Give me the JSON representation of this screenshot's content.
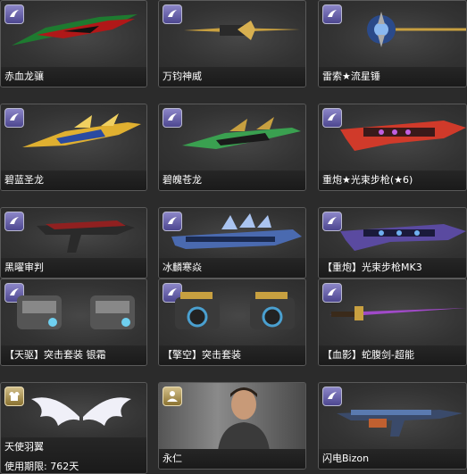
{
  "items": [
    {
      "name": "赤血龙骧",
      "badge": "weapon-category-icon",
      "accent": "#c02020"
    },
    {
      "name": "万钧神威",
      "badge": "weapon-category-icon",
      "accent": "#c8a040"
    },
    {
      "name": "雷索★流星锤",
      "badge": "weapon-category-icon",
      "accent": "#3b6fd0"
    },
    {
      "name": "碧蓝圣龙",
      "badge": "weapon-category-icon",
      "accent": "#e0b030"
    },
    {
      "name": "碧魄苍龙",
      "badge": "weapon-category-icon",
      "accent": "#3aa050"
    },
    {
      "name": "重炮★光束步枪(★6)",
      "badge": "weapon-category-icon",
      "accent": "#d03a2a"
    },
    {
      "name": "黑曜审判",
      "badge": "weapon-category-icon",
      "accent": "#902020"
    },
    {
      "name": "冰麟寒焱",
      "badge": "weapon-category-icon",
      "accent": "#4a6ab0"
    },
    {
      "name": "【重炮】光束步枪MK3",
      "badge": "weapon-category-icon",
      "accent": "#6a4ac0"
    },
    {
      "name": "【天驱】突击套装 银霜",
      "badge": "weapon-category-icon",
      "accent": "#6fb0d8"
    },
    {
      "name": "【擎空】突击套装",
      "badge": "weapon-category-icon",
      "accent": "#4aa0d0"
    },
    {
      "name": "【血影】蛇腹剑-超能",
      "badge": "weapon-category-icon",
      "accent": "#a04ac8"
    },
    {
      "name": "天使羽翼",
      "badge": "costume-shirt-icon",
      "accent": "#e8e8f0",
      "expiry": "使用期限: 762天"
    },
    {
      "name": "永仁",
      "badge": "character-person-icon",
      "accent": "#7a6a50"
    },
    {
      "name": "闪电Bizon",
      "badge": "weapon-category-icon",
      "accent": "#5a7ab0"
    }
  ]
}
